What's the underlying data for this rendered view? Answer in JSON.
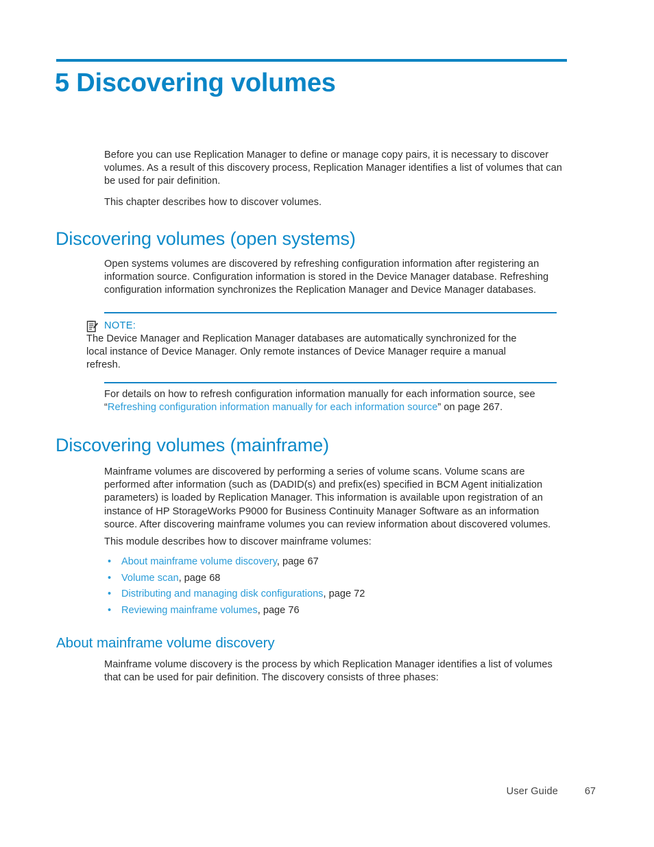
{
  "page": {
    "chapter_number": "5",
    "chapter_title": "5 Discovering volumes",
    "accent_color": "#0a85c6",
    "rule_color": "#0b84c2",
    "link_color": "#2a9cd8",
    "body_color": "#2b2b2b"
  },
  "intro": {
    "paragraph_1": "Before you can use Replication Manager to define or manage copy pairs, it is necessary to discover volumes. As a result of this discovery process, Replication Manager identifies a list of volumes that can be used for pair definition.",
    "paragraph_2": "This chapter describes how to discover volumes."
  },
  "open_systems": {
    "heading": "Discovering volumes (open systems)",
    "paragraph": "Open systems volumes are discovered by refreshing configuration information after registering an information source. Configuration information is stored in the Device Manager database. Refreshing configuration information synchronizes the Replication Manager and Device Manager databases.",
    "note": {
      "icon": "note-icon",
      "label": "NOTE:",
      "text": "The Device Manager and Replication Manager databases are automatically synchronized for the local instance of Device Manager. Only remote instances of Device Manager require a manual refresh."
    },
    "xref": {
      "lead_text": "For details on how to refresh configuration information manually for each information source, see “",
      "link_text": "Refreshing configuration information manually for each information source",
      "trail_text": "” on page 267."
    }
  },
  "mainframe": {
    "heading": "Discovering volumes (mainframe)",
    "paragraph": "Mainframe volumes are discovered by performing a series of volume scans. Volume scans are performed after information (such as (DADID(s) and prefix(es) specified in BCM Agent initialization parameters) is loaded by Replication Manager. This information is available upon registration of an instance of HP StorageWorks P9000 for Business Continuity Manager Software as an information source. After discovering mainframe volumes you can review information about discovered volumes.",
    "module_intro": "This module describes how to discover mainframe volumes:",
    "bullet": "•",
    "links": [
      {
        "link_text": "About mainframe volume discovery",
        "page_text": ", page 67"
      },
      {
        "link_text": "Volume scan",
        "page_text": ", page 68"
      },
      {
        "link_text": "Distributing and managing disk configurations",
        "page_text": ", page 72"
      },
      {
        "link_text": "Reviewing mainframe volumes",
        "page_text": ", page 76"
      }
    ]
  },
  "about_discovery": {
    "heading": "About mainframe volume discovery",
    "paragraph": "Mainframe volume discovery is the process by which Replication Manager identifies a list of volumes that can be used for pair definition. The discovery consists of three phases:"
  },
  "footer": {
    "guide_label": "User Guide",
    "page_number": "67"
  }
}
